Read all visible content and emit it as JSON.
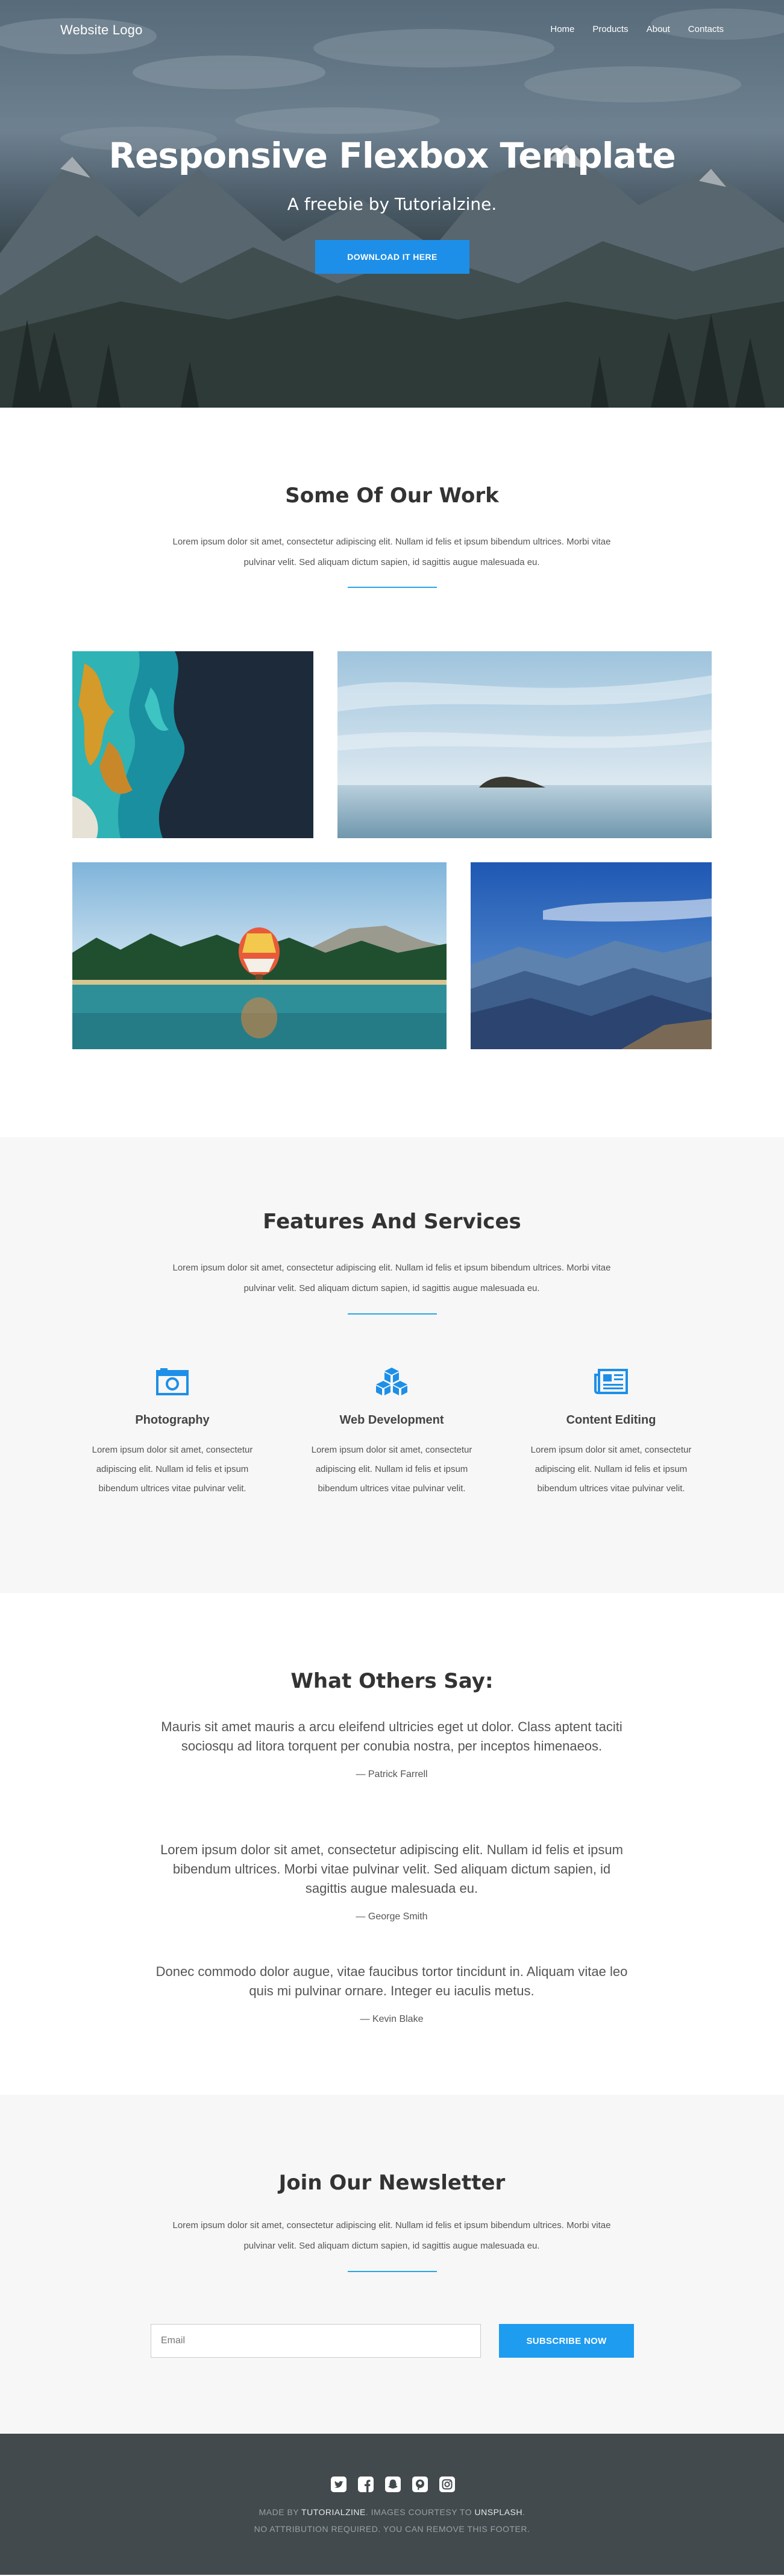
{
  "header": {
    "logo": "Website Logo",
    "nav": [
      "Home",
      "Products",
      "About",
      "Contacts"
    ],
    "title": "Responsive Flexbox Template",
    "subtitle": "A freebie by Tutorialzine.",
    "cta": "DOWNLOAD IT HERE"
  },
  "work": {
    "title": "Some Of Our Work",
    "text": "Lorem ipsum dolor sit amet, consectetur adipiscing elit. Nullam id felis et ipsum bibendum ultrices. Morbi vitae pulvinar velit. Sed aliquam dictum sapien, id sagittis augue malesuada eu.",
    "photos": [
      "ocean-aerial",
      "lone-island",
      "hot-air-balloon-lake",
      "blue-mountains"
    ]
  },
  "features": {
    "title": "Features And Services",
    "text": "Lorem ipsum dolor sit amet, consectetur adipiscing elit. Nullam id felis et ipsum bibendum ultrices. Morbi vitae pulvinar velit. Sed aliquam dictum sapien, id sagittis augue malesuada eu.",
    "items": [
      {
        "icon": "camera-icon",
        "title": "Photography",
        "text": "Lorem ipsum dolor sit amet, consectetur adipiscing elit. Nullam id felis et ipsum bibendum ultrices vitae pulvinar velit."
      },
      {
        "icon": "cubes-icon",
        "title": "Web Development",
        "text": "Lorem ipsum dolor sit amet, consectetur adipiscing elit. Nullam id felis et ipsum bibendum ultrices vitae pulvinar velit."
      },
      {
        "icon": "newspaper-icon",
        "title": "Content Editing",
        "text": "Lorem ipsum dolor sit amet, consectetur adipiscing elit. Nullam id felis et ipsum bibendum ultrices vitae pulvinar velit."
      }
    ]
  },
  "testimonials": {
    "title": "What Others Say:",
    "quotes": [
      {
        "text": "Mauris sit amet mauris a arcu eleifend ultricies eget ut dolor. Class aptent taciti sociosqu ad litora torquent per conubia nostra, per inceptos himenaeos.",
        "author": "— Patrick Farrell"
      },
      {
        "text": "Lorem ipsum dolor sit amet, consectetur adipiscing elit. Nullam id felis et ipsum bibendum ultrices. Morbi vitae pulvinar velit. Sed aliquam dictum sapien, id sagittis augue malesuada eu.",
        "author": "— George Smith"
      },
      {
        "text": "Donec commodo dolor augue, vitae faucibus tortor tincidunt in. Aliquam vitae leo quis mi pulvinar ornare. Integer eu iaculis metus.",
        "author": "— Kevin Blake"
      }
    ]
  },
  "newsletter": {
    "title": "Join Our Newsletter",
    "text": "Lorem ipsum dolor sit amet, consectetur adipiscing elit. Nullam id felis et ipsum bibendum ultrices. Morbi vitae pulvinar velit. Sed aliquam dictum sapien, id sagittis augue malesuada eu.",
    "placeholder": "Email",
    "button": "SUBSCRIBE NOW"
  },
  "footer": {
    "social": [
      "twitter-icon",
      "facebook-icon",
      "snapchat-icon",
      "pinterest-icon",
      "instagram-icon"
    ],
    "made_by": "MADE BY",
    "tutorialzine": "TUTORIALZINE",
    "images_courtesy": ". IMAGES COURTESY TO",
    "unsplash": "UNSPLASH",
    "period": ".",
    "line2": "NO ATTRIBUTION REQUIRED. YOU CAN REMOVE THIS FOOTER."
  },
  "colors": {
    "accent": "#1d8fe8",
    "footer_bg": "#424a4d",
    "section_alt_bg": "#f7f7f7"
  }
}
